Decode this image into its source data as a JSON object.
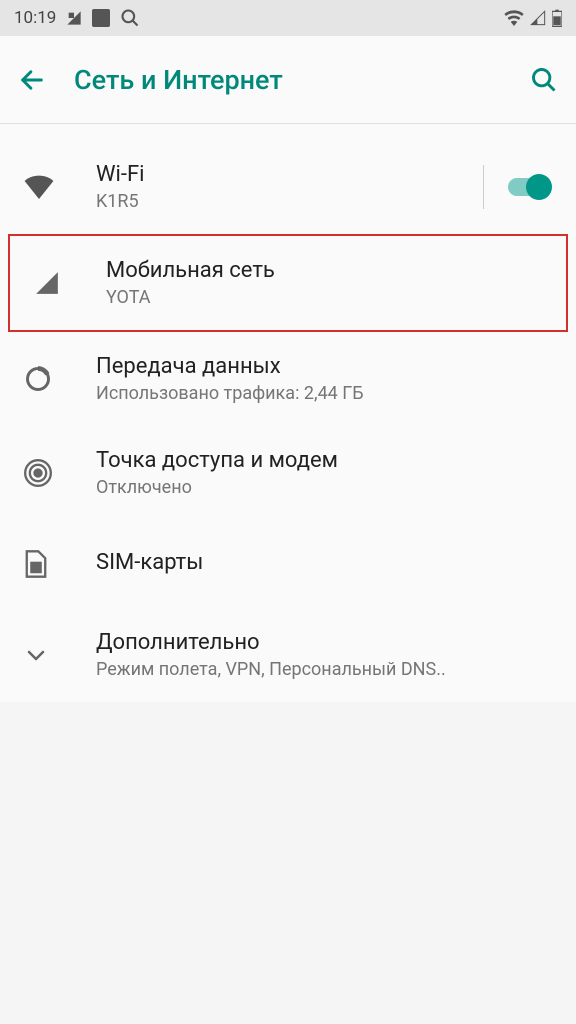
{
  "status_bar": {
    "time": "10:19"
  },
  "header": {
    "title": "Сеть и Интернет"
  },
  "items": [
    {
      "title": "Wi-Fi",
      "subtitle": "K1R5",
      "toggle": true
    },
    {
      "title": "Мобильная сеть",
      "subtitle": "YOTA",
      "highlighted": true
    },
    {
      "title": "Передача данных",
      "subtitle": "Использовано трафика: 2,44 ГБ"
    },
    {
      "title": "Точка доступа и модем",
      "subtitle": "Отключено"
    },
    {
      "title": "SIM-карты",
      "subtitle": ""
    },
    {
      "title": "Дополнительно",
      "subtitle": "Режим полета, VPN, Персональный DNS.."
    }
  ]
}
